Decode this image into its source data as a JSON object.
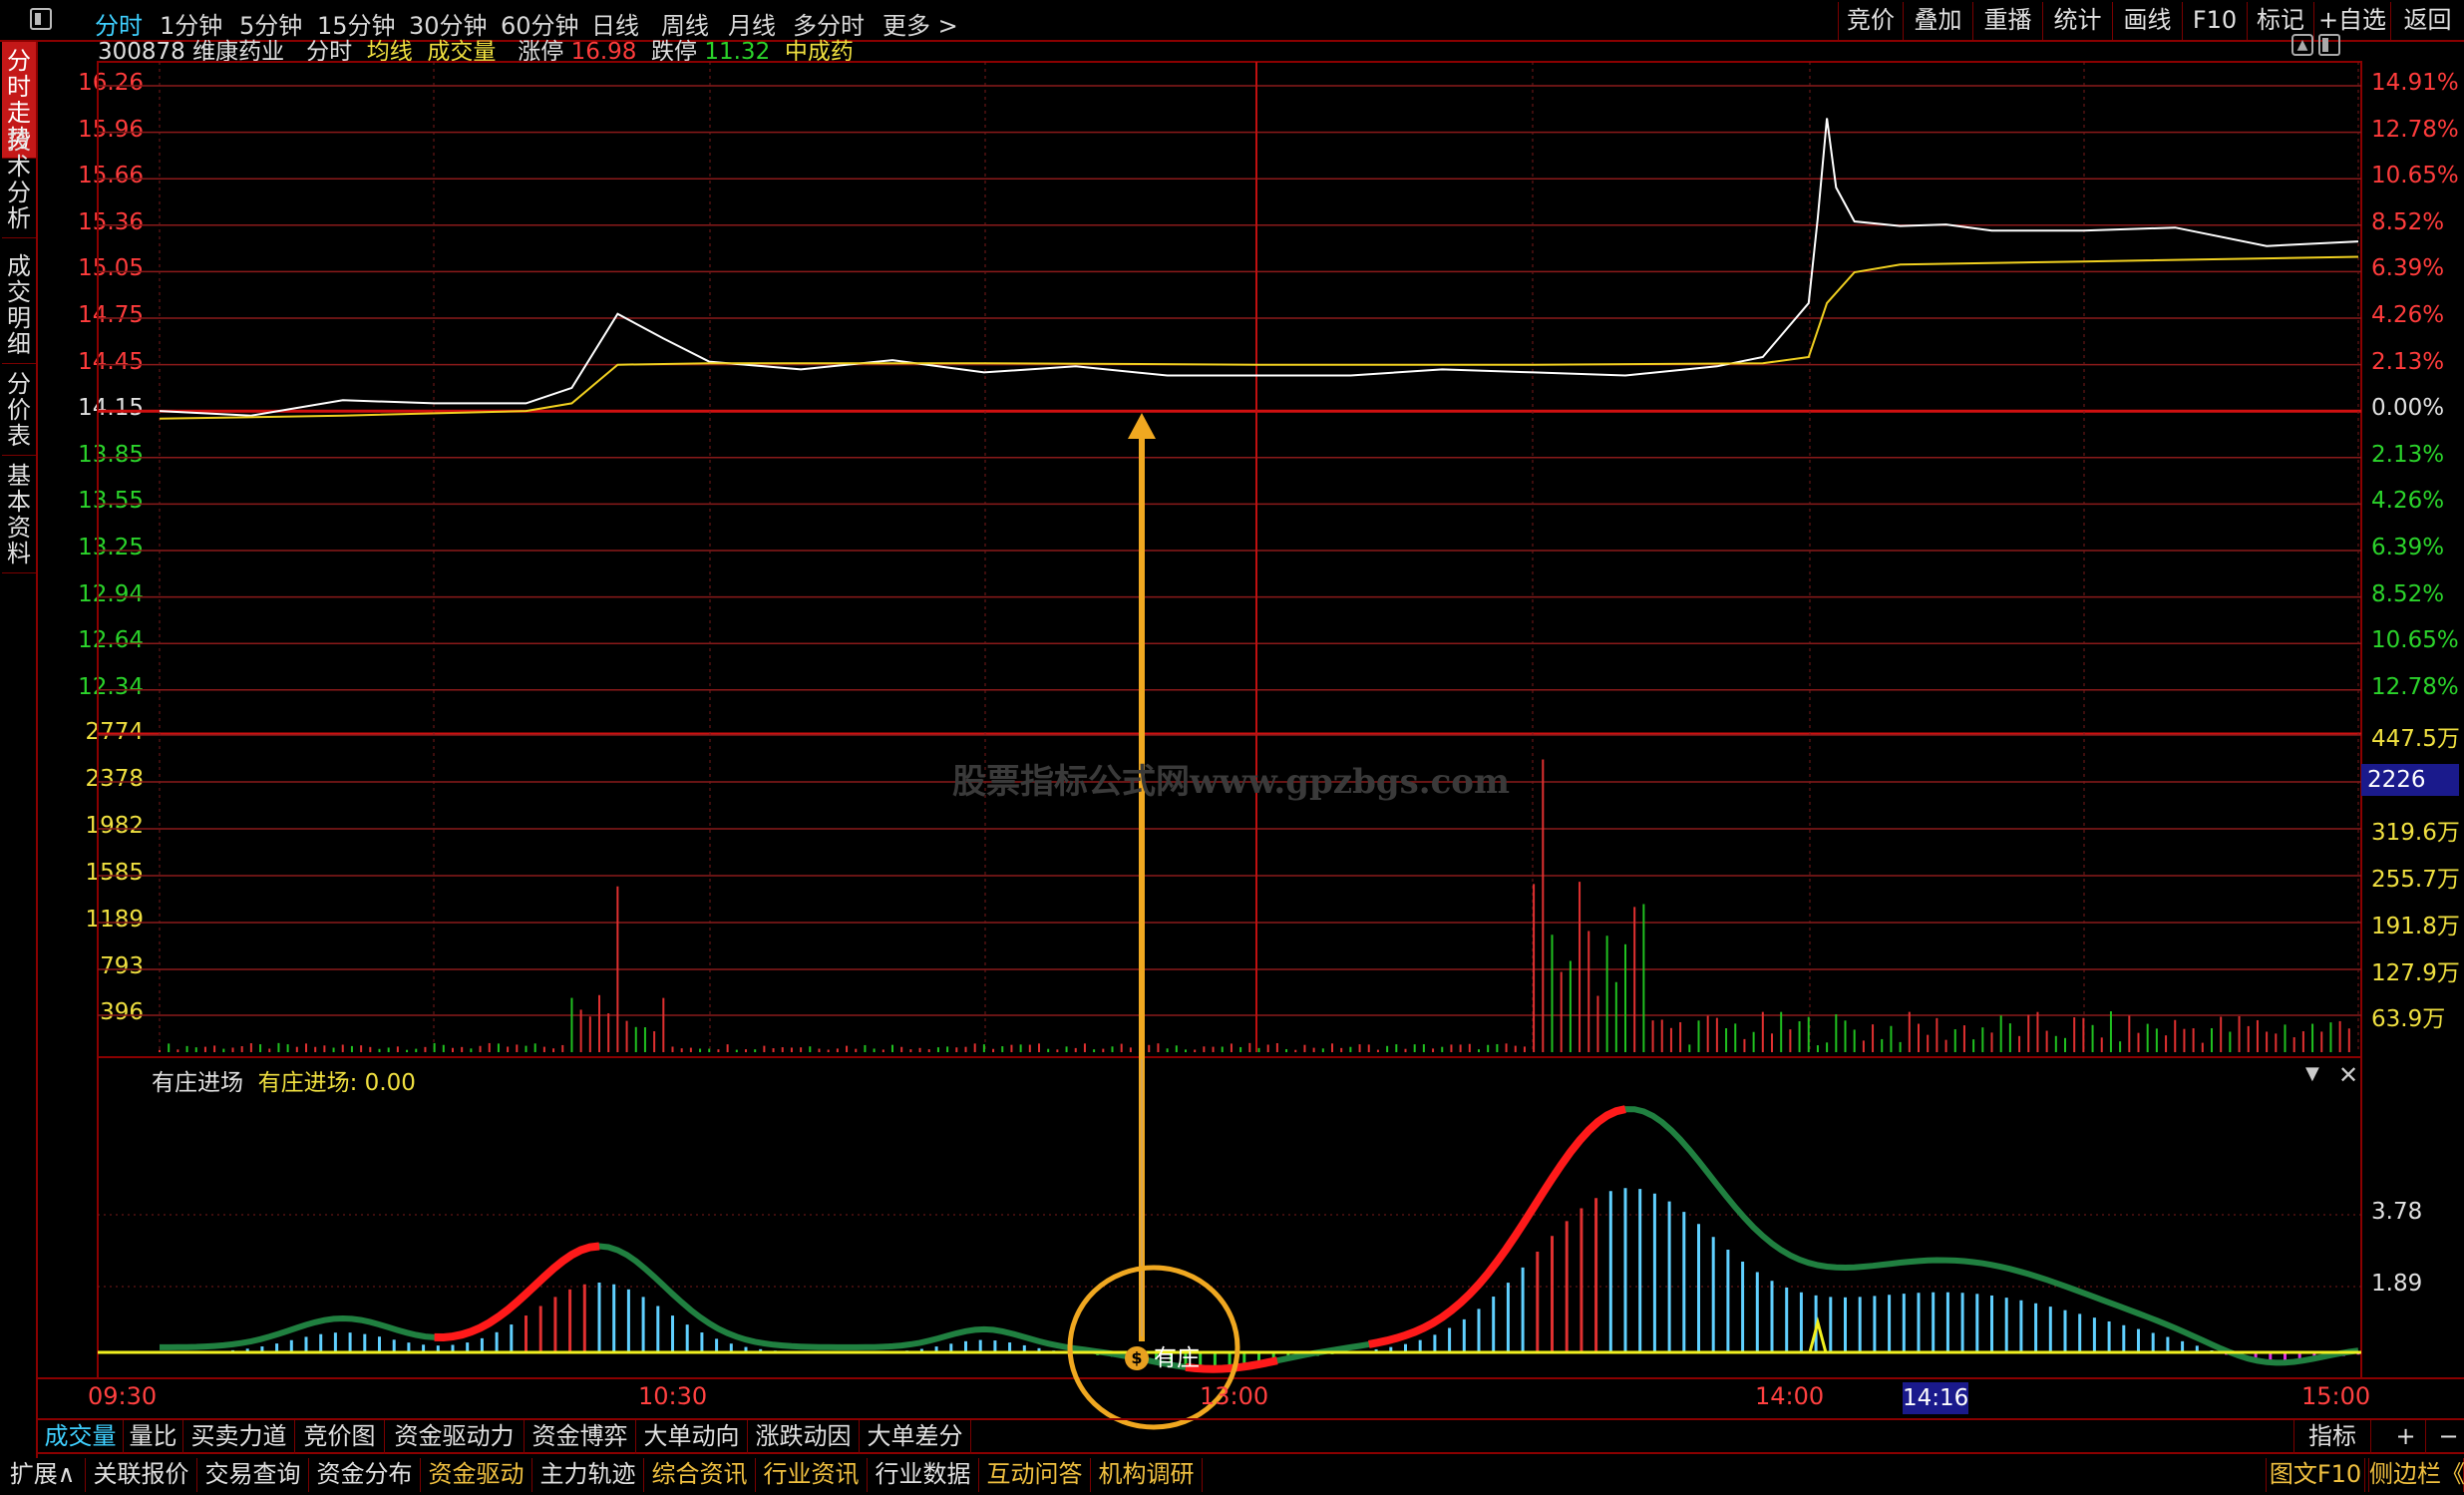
{
  "topbar": {
    "period_tabs": [
      "分时",
      "1分钟",
      "5分钟",
      "15分钟",
      "30分钟",
      "60分钟",
      "日线",
      "周线",
      "月线",
      "多分时",
      "更多 >"
    ],
    "active_tab": "分时",
    "right_buttons": [
      "竞价",
      "叠加",
      "重播",
      "统计",
      "画线",
      "F10",
      "标记",
      "+自选",
      "返回"
    ]
  },
  "sidebar": {
    "tabs": [
      "分时走势",
      "技术分析",
      "成交明细",
      "分价表",
      "基本资料"
    ],
    "active": "分时走势"
  },
  "header": {
    "code": "300878",
    "name": "维康药业",
    "mode": "分时",
    "avg_label": "均线",
    "vol_label": "成交量",
    "limit_up_label": "涨停",
    "limit_up_value": "16.98",
    "limit_down_label": "跌停",
    "limit_down_value": "11.32",
    "sector": "中成药"
  },
  "price_axis": {
    "left": [
      "16.26",
      "15.96",
      "15.66",
      "15.36",
      "15.05",
      "14.75",
      "14.45",
      "14.15",
      "13.85",
      "13.55",
      "13.25",
      "12.94",
      "12.64",
      "12.34"
    ],
    "right": [
      "14.91%",
      "12.78%",
      "10.65%",
      "8.52%",
      "6.39%",
      "4.26%",
      "2.13%",
      "0.00%",
      "2.13%",
      "4.26%",
      "6.39%",
      "8.52%",
      "10.65%",
      "12.78%"
    ]
  },
  "volume_axis": {
    "left": [
      "2774",
      "2378",
      "1982",
      "1585",
      "1189",
      "793",
      "396"
    ],
    "right": [
      "447.5万",
      "",
      "319.6万",
      "255.7万",
      "191.8万",
      "127.9万",
      "63.9万"
    ],
    "highlight_value": "2226"
  },
  "watermark": "股票指标公式网www.gpzbgs.com",
  "indicator": {
    "name": "有庄进场",
    "value_label": "有庄进场: 0.00",
    "axis": [
      "3.78",
      "1.89"
    ],
    "signal_label": "有庄",
    "signal_icon": "money-bag-icon"
  },
  "time_axis": {
    "labels": [
      "09:30",
      "10:30",
      "13:00",
      "14:00",
      "15:00"
    ],
    "cursor_time": "14:16"
  },
  "bottom_tabs": [
    "成交量",
    "量比",
    "买卖力道",
    "竞价图",
    "资金驱动力",
    "资金博弈",
    "大单动向",
    "涨跌动因",
    "大单差分"
  ],
  "bottom_right": {
    "indicator_label": "指标",
    "plus": "+",
    "minus": "−"
  },
  "footer_tabs": [
    "扩展∧",
    "关联报价",
    "交易查询",
    "资金分布",
    "资金驱动",
    "主力轨迹",
    "综合资讯",
    "行业资讯",
    "行业数据",
    "互动问答",
    "机构调研"
  ],
  "footer_right": [
    "图文F10",
    "侧边栏《"
  ],
  "chart_data": {
    "type": "line",
    "title": "",
    "prev_close": 14.15,
    "ylim": [
      12.34,
      16.26
    ],
    "x_range": [
      "09:30",
      "15:00"
    ],
    "series": [
      {
        "name": "",
        "x": [
          "09:30",
          "09:40",
          "09:50",
          "10:00",
          "10:10",
          "10:15",
          "10:20",
          "10:25",
          "10:30",
          "10:40",
          "10:50",
          "11:00",
          "11:10",
          "11:20",
          "11:30",
          "13:10",
          "13:20",
          "13:30",
          "13:40",
          "13:50",
          "13:55",
          "14:00",
          "14:01",
          "14:02",
          "14:03",
          "14:05",
          "14:10",
          "14:15",
          "14:20",
          "14:30",
          "14:40",
          "14:50",
          "15:00"
        ],
        "values": [
          14.15,
          14.12,
          14.22,
          14.2,
          14.2,
          14.3,
          14.78,
          14.62,
          14.47,
          14.42,
          14.48,
          14.4,
          14.44,
          14.38,
          14.38,
          14.38,
          14.42,
          14.4,
          14.38,
          14.44,
          14.5,
          14.85,
          15.4,
          16.05,
          15.6,
          15.38,
          15.35,
          15.36,
          15.32,
          15.32,
          15.34,
          15.22,
          15.25
        ]
      },
      {
        "name": "均线",
        "x": [
          "09:30",
          "09:50",
          "10:10",
          "10:15",
          "10:20",
          "10:30",
          "11:00",
          "11:30",
          "13:30",
          "13:55",
          "14:00",
          "14:02",
          "14:05",
          "14:10",
          "14:30",
          "15:00"
        ],
        "values": [
          14.1,
          14.12,
          14.15,
          14.2,
          14.45,
          14.46,
          14.46,
          14.45,
          14.45,
          14.46,
          14.5,
          14.85,
          15.05,
          15.1,
          15.12,
          15.15
        ]
      }
    ],
    "volume_peaks": [
      {
        "time": "10:20",
        "value": 1450
      },
      {
        "time": "14:01",
        "value": 2560
      }
    ]
  }
}
